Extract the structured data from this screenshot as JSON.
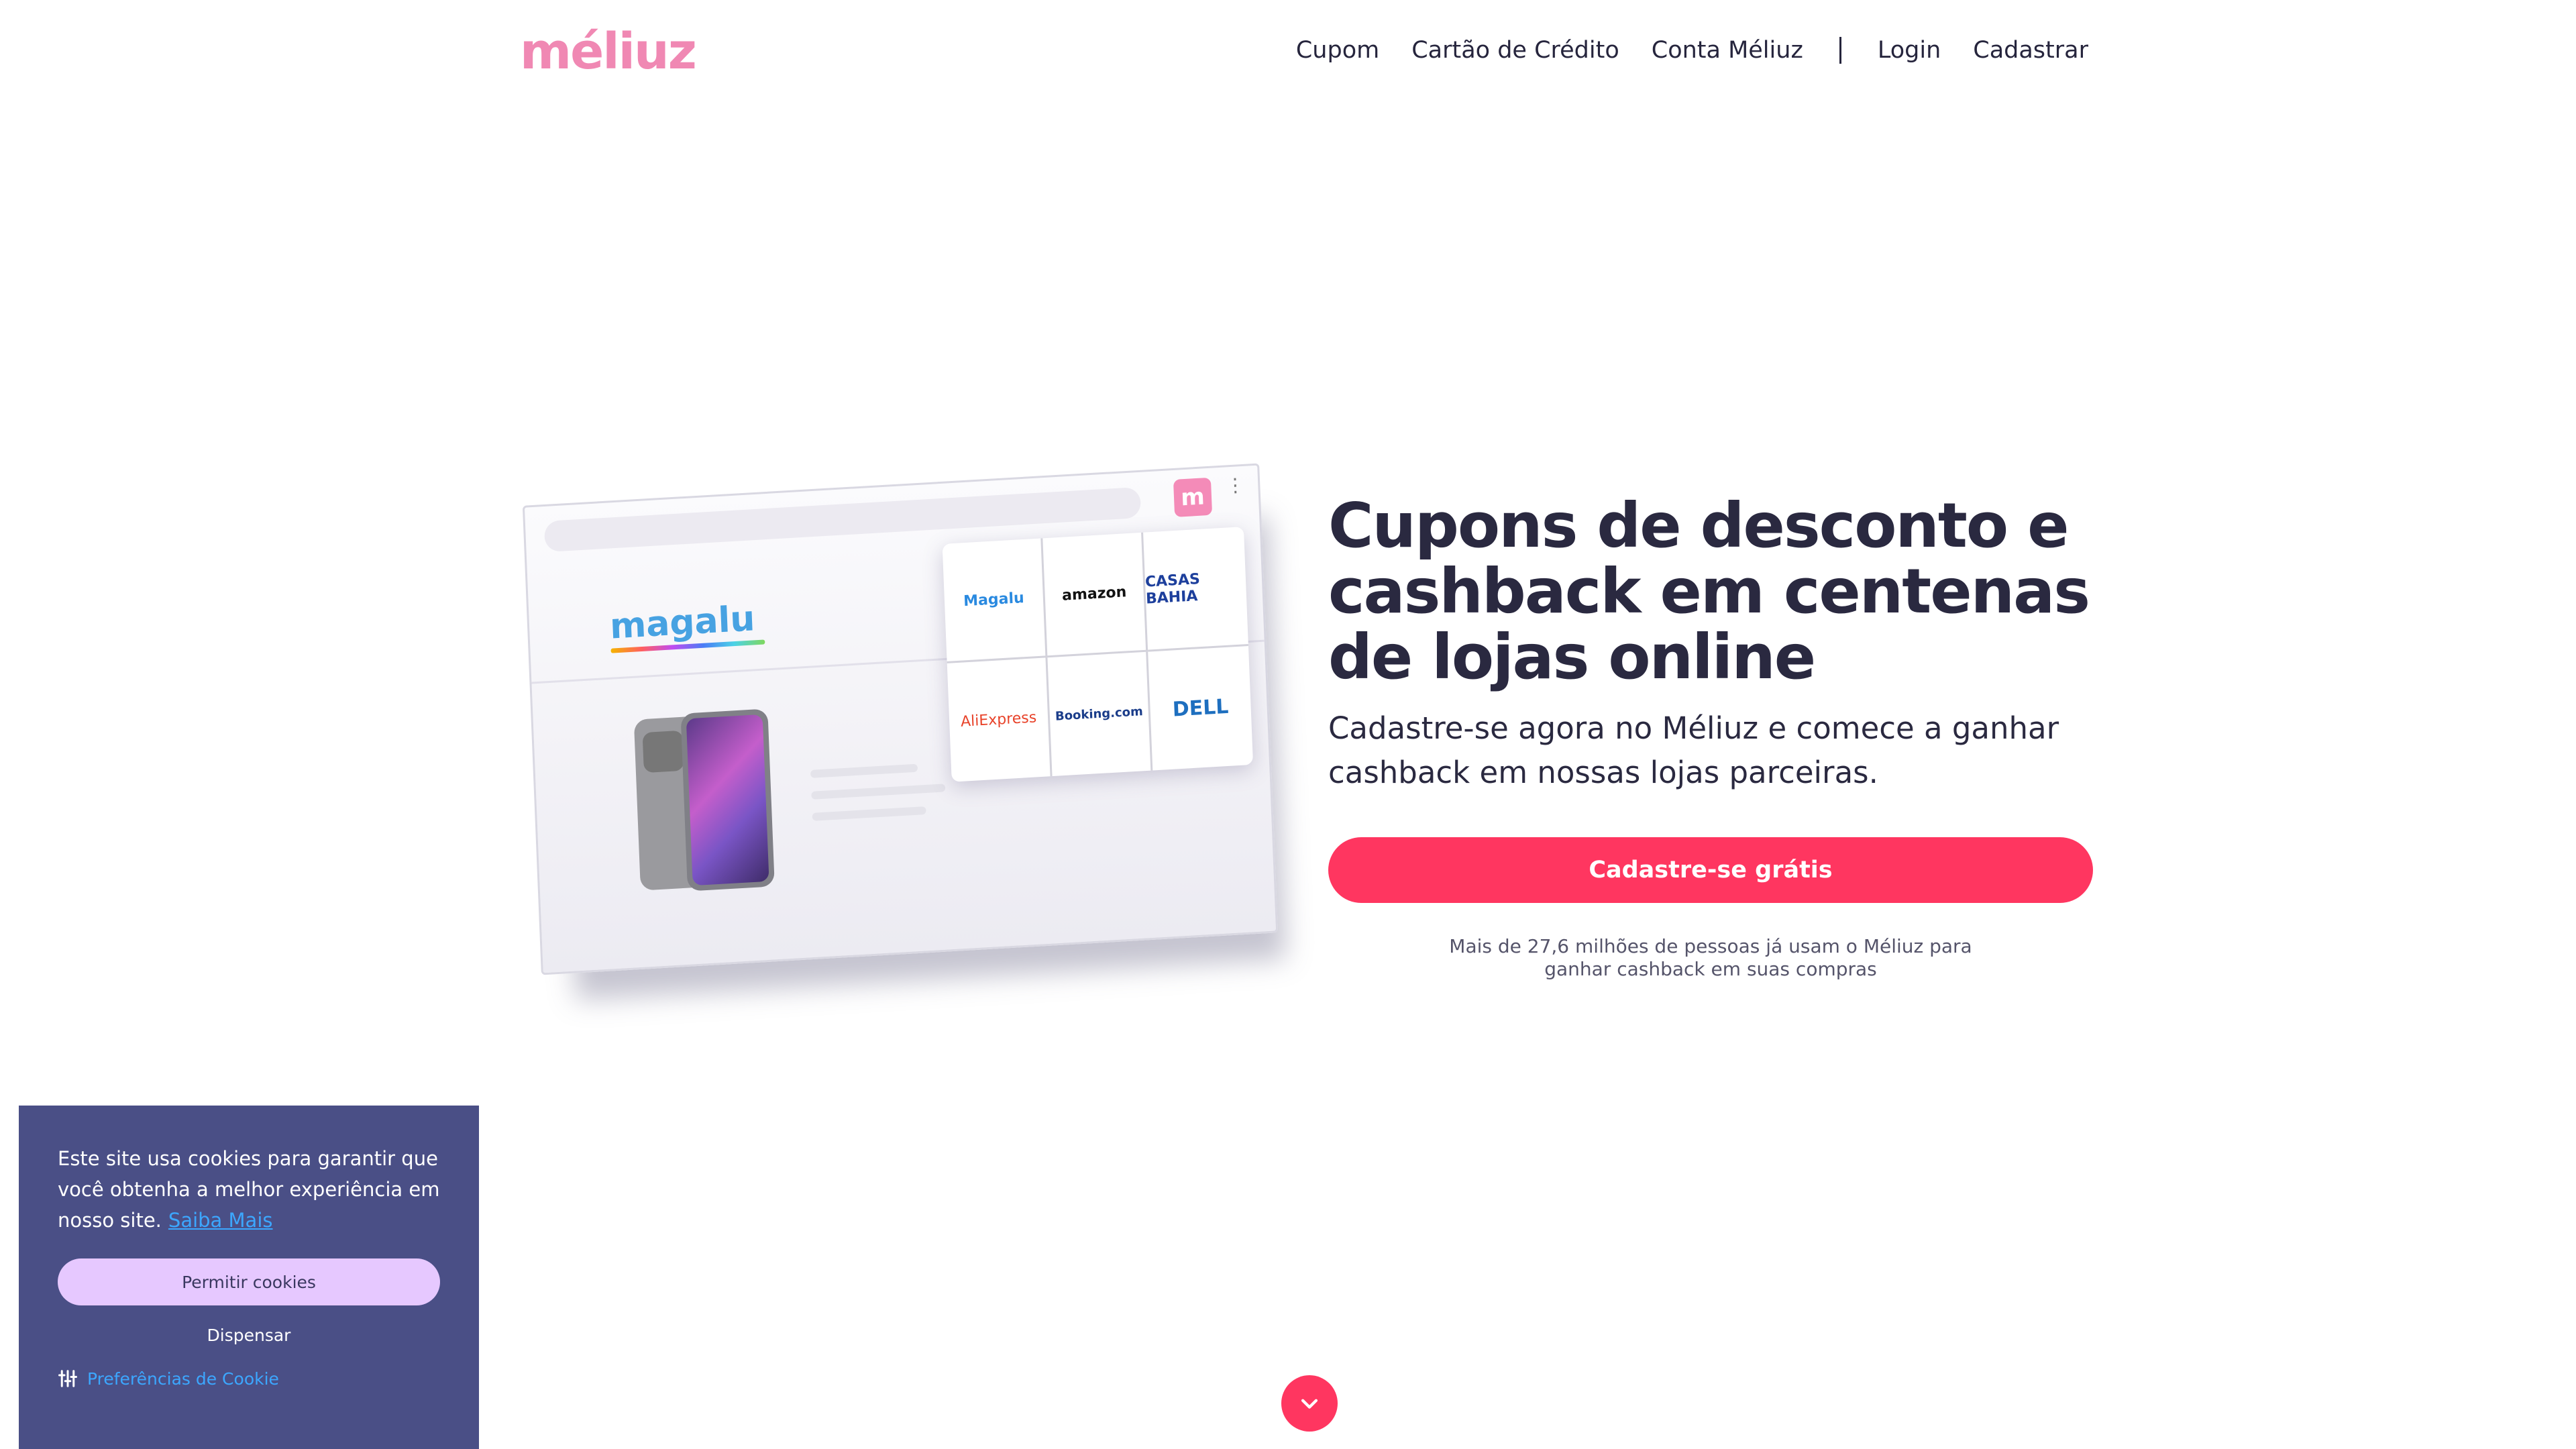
{
  "header": {
    "logo": "méliuz",
    "nav": [
      "Cupom",
      "Cartão de Crédito",
      "Conta Méliuz",
      "Login",
      "Cadastrar"
    ]
  },
  "illustration": {
    "store_logo": "magalu",
    "extension_icon": "m",
    "partner_stores": [
      "Magalu",
      "amazon",
      "CASAS BAHIA",
      "AliExpress",
      "Booking.com",
      "DELL"
    ]
  },
  "hero": {
    "title": "Cupons de desconto e cashback em centenas de lojas online",
    "subtitle": "Cadastre-se agora no Méliuz e comece a ganhar cashback em nossas lojas parceiras.",
    "cta": "Cadastre-se grátis",
    "users_line1": "Mais de 27,6 milhões de pessoas já usam o Méliuz para",
    "users_line2": "ganhar cashback em suas compras"
  },
  "cookie": {
    "message": "Este site usa cookies para garantir que você obtenha a melhor experiência em nosso site.",
    "learn_more": "Saiba Mais",
    "allow": "Permitir cookies",
    "dismiss": "Dispensar",
    "preferences": "Preferências de Cookie"
  },
  "icons": {
    "scroll_down": "chevron-down-icon",
    "preferences": "sliders-icon"
  },
  "colors": {
    "brand_pink": "#f088b3",
    "cta_red": "#ff3660",
    "cookie_bg": "#4a4f86",
    "cookie_button": "#e6c8ff",
    "link_blue": "#3ca7ff",
    "text_dark": "#2a2940"
  }
}
